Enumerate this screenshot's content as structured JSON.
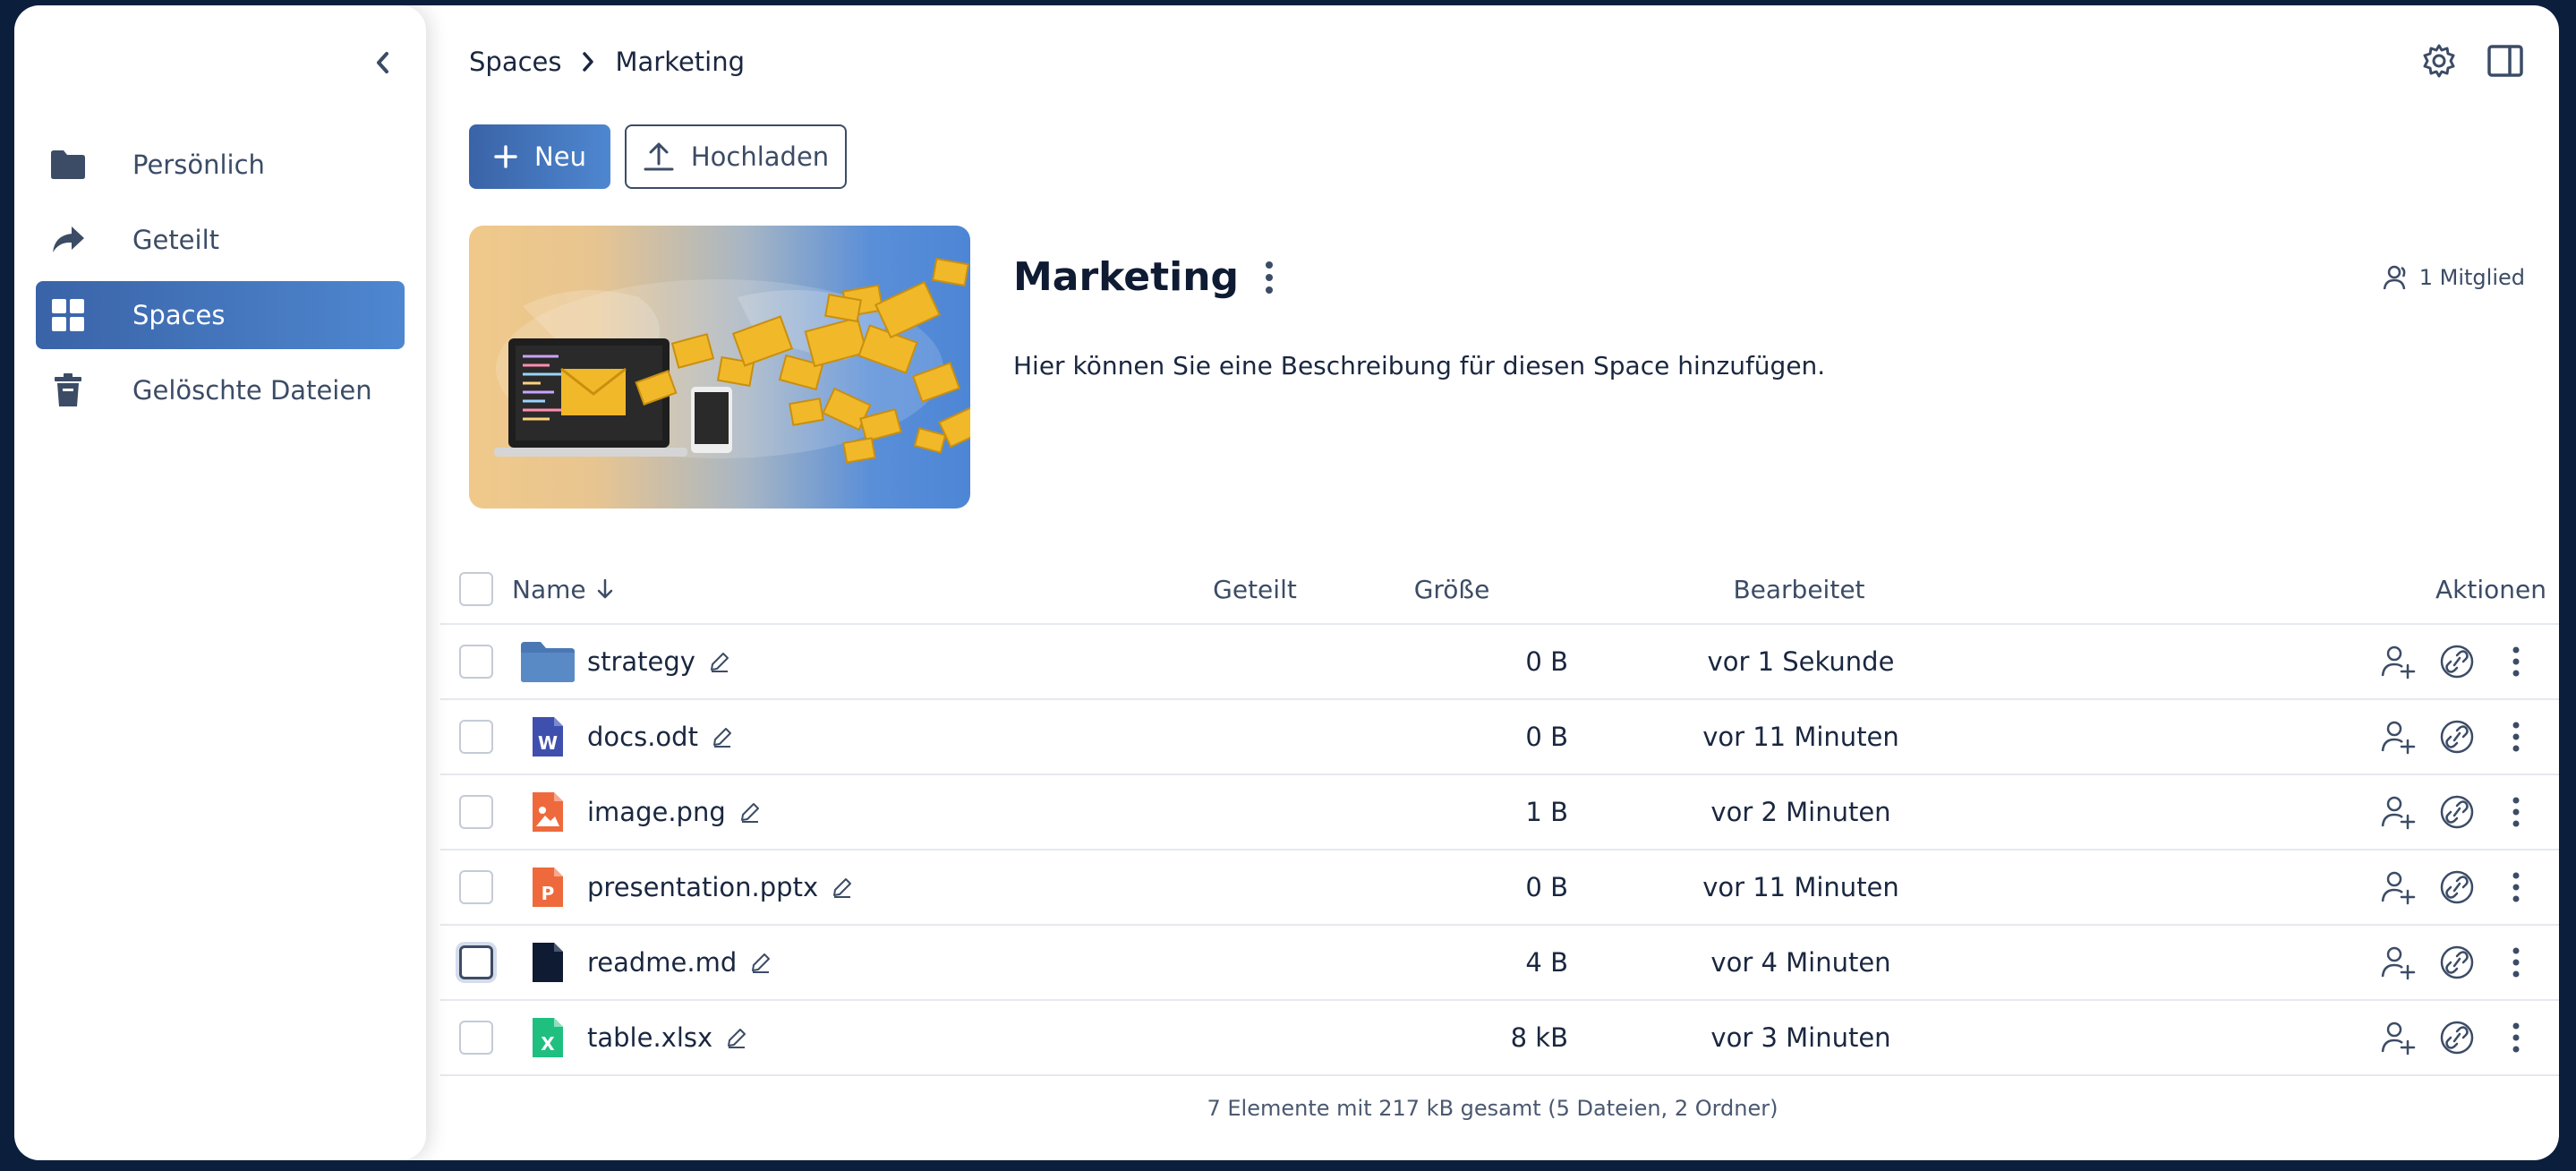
{
  "sidebar": {
    "items": [
      {
        "label": "Persönlich",
        "icon": "folder-icon"
      },
      {
        "label": "Geteilt",
        "icon": "share-icon"
      },
      {
        "label": "Spaces",
        "icon": "spaces-grid-icon",
        "active": true
      },
      {
        "label": "Gelöschte Dateien",
        "icon": "trash-icon"
      }
    ]
  },
  "breadcrumb": {
    "root": "Spaces",
    "current": "Marketing"
  },
  "toolbar": {
    "new_label": "Neu",
    "upload_label": "Hochladen"
  },
  "space": {
    "title": "Marketing",
    "members": "1 Mitglied",
    "description": "Hier können Sie eine Beschreibung für diesen Space hinzufügen."
  },
  "table": {
    "headers": {
      "name": "Name",
      "shared": "Geteilt",
      "size": "Größe",
      "edited": "Bearbeitet",
      "actions": "Aktionen"
    },
    "rows": [
      {
        "name": "strategy",
        "type": "folder",
        "size": "0 B",
        "edited": "vor 1 Sekunde"
      },
      {
        "name": "docs.odt",
        "type": "doc",
        "size": "0 B",
        "edited": "vor 11 Minuten"
      },
      {
        "name": "image.png",
        "type": "image",
        "size": "1 B",
        "edited": "vor 2 Minuten"
      },
      {
        "name": "presentation.pptx",
        "type": "presentation",
        "size": "0 B",
        "edited": "vor 11 Minuten"
      },
      {
        "name": "readme.md",
        "type": "text",
        "size": "4 B",
        "edited": "vor 4 Minuten"
      },
      {
        "name": "table.xlsx",
        "type": "spreadsheet",
        "size": "8 kB",
        "edited": "vor 3 Minuten"
      }
    ]
  },
  "footer": {
    "summary": "7 Elemente mit 217 kB gesamt (5 Dateien, 2 Ordner)"
  },
  "colors": {
    "accent": "#3a63a7",
    "accent_light": "#4e87d0",
    "text": "#1a2740",
    "muted": "#3c4c66"
  }
}
